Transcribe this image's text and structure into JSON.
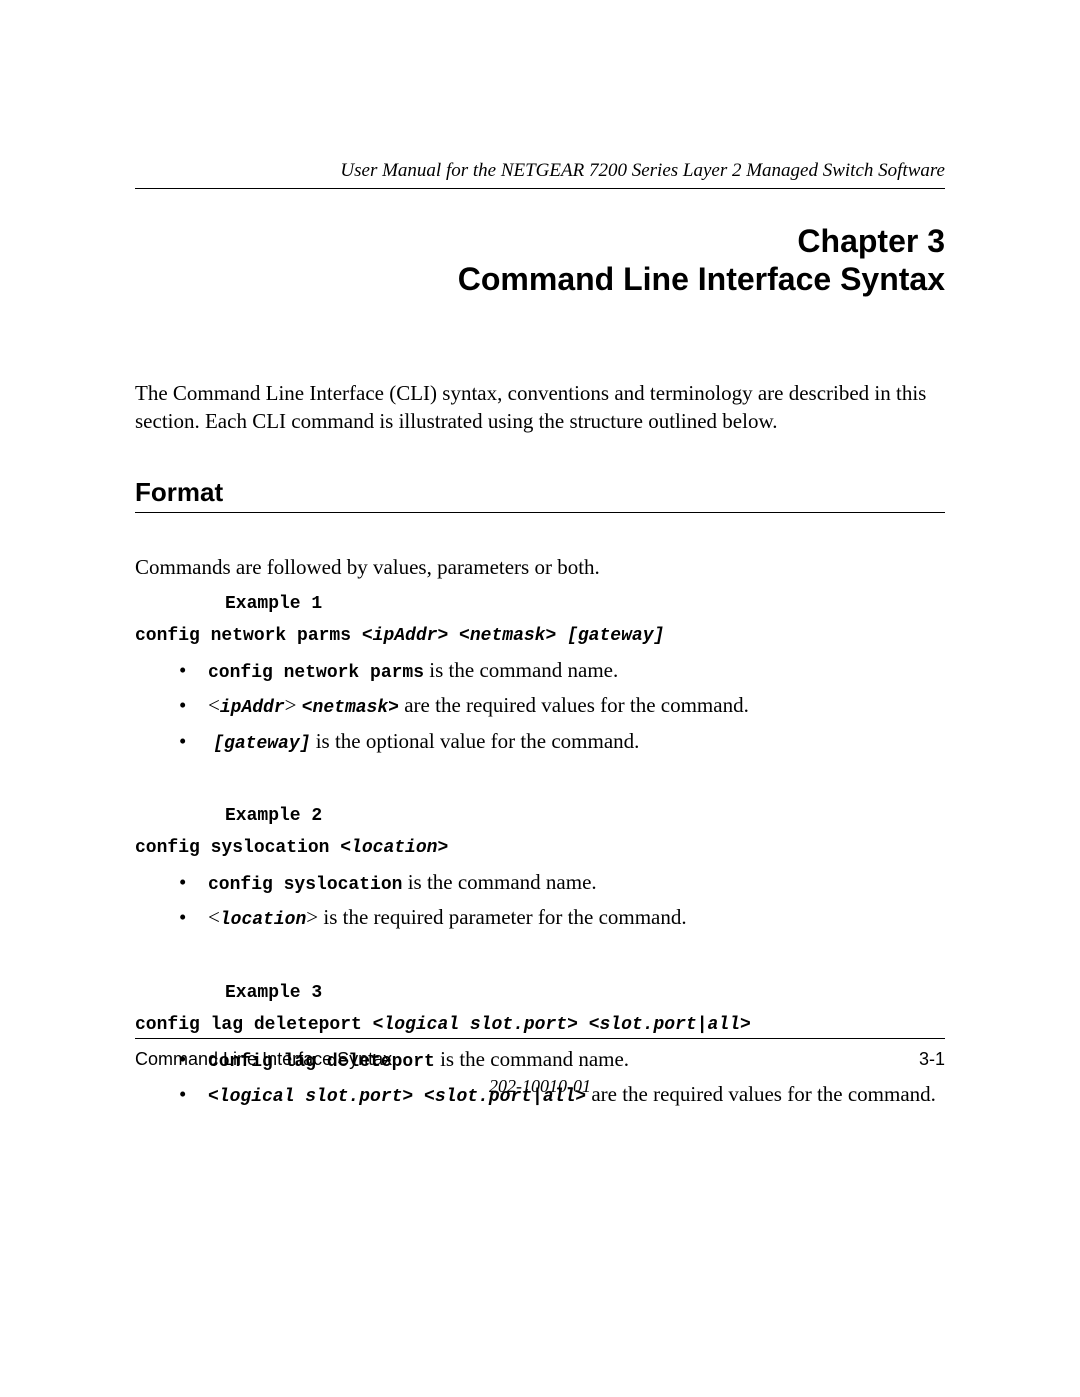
{
  "header": {
    "running_title": "User Manual for the NETGEAR 7200 Series Layer 2 Managed Switch Software"
  },
  "chapter": {
    "line1": "Chapter 3",
    "line2": "Command Line Interface Syntax"
  },
  "intro": "The Command Line Interface (CLI) syntax, conventions and terminology are described in this section. Each CLI command is illustrated using the structure outlined below.",
  "section_heading": "Format",
  "lead_text": "Commands are followed by values, parameters or both.",
  "example1": {
    "label": "Example 1",
    "cmd_plain": "config network parms ",
    "cmd_ital": "<ipAddr> <netmask> [gateway]",
    "b1_mono": "config network parms",
    "b1_rest": " is the command name.",
    "b2_open": "<",
    "b2_p1": "ipAddr",
    "b2_close": "> ",
    "b2_p2": "<netmask>",
    "b2_rest": "  are the required values for the command.",
    "b3_p": "[gateway]",
    "b3_rest": "  is the optional value for the command."
  },
  "example2": {
    "label": "Example 2",
    "cmd_plain": "config syslocation <",
    "cmd_ital": "location",
    "cmd_close": ">",
    "b1_mono": "config syslocation",
    "b1_rest": "  is the command name.",
    "b2_open": "<",
    "b2_p": "location",
    "b2_close": ">",
    "b2_rest": "   is the required parameter for the command."
  },
  "example3": {
    "label": "Example 3",
    "cmd_plain": "config lag deleteport <",
    "cmd_ital1": "logical slot.port",
    "cmd_mid": "> <",
    "cmd_ital2": "slot.port|all",
    "cmd_close": ">",
    "b1_mono": "config lag deleteport",
    "b1_rest": " is the command name.",
    "b2_p": "<logical slot.port> <slot.port|all>",
    "b2_rest": "  are the required values for the command."
  },
  "footer": {
    "left": "Command Line Interface Syntax",
    "right": "3-1",
    "docnum": "202-10010-01"
  }
}
